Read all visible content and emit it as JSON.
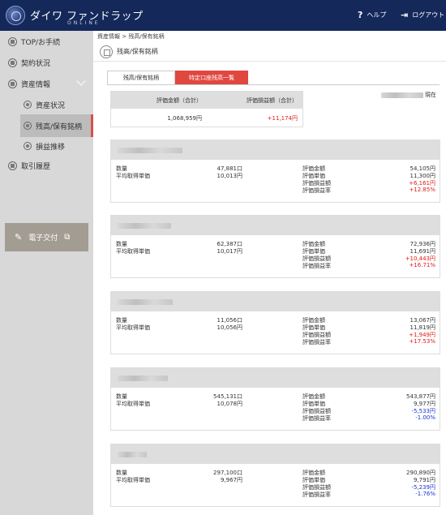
{
  "header": {
    "logo_text": "ダイワ ファンドラップ",
    "logo_sub": "ONLINE",
    "help_label": "ヘルプ",
    "logout_label": "ログアウト"
  },
  "sidebar": {
    "items": [
      {
        "label": "TOP/お手続"
      },
      {
        "label": "契約状況"
      },
      {
        "label": "資産情報"
      },
      {
        "label": "資産状況"
      },
      {
        "label": "残高/保有銘柄"
      },
      {
        "label": "損益推移"
      },
      {
        "label": "取引履歴"
      }
    ],
    "edoc_label": "電子交付"
  },
  "main": {
    "breadcrumb": "資産情報 > 残高/保有銘柄",
    "title": "残高/保有銘柄",
    "tabs": [
      {
        "label": "残高/保有銘柄"
      },
      {
        "label": "特定口座残高一覧"
      }
    ],
    "asof_suffix": "現在",
    "summary": {
      "col1_label": "評価金額（合計）",
      "col2_label": "評価損益額（合計）",
      "col1_value": "1,068,959円",
      "col2_value": "+11,174円"
    },
    "labels": {
      "quantity": "数量",
      "avg_price": "平均取得単価",
      "eval_amount": "評価金額",
      "eval_price": "評価単価",
      "gain_amount": "評価損益額",
      "gain_rate": "評価損益率"
    },
    "holdings": [
      {
        "quantity": "47,881口",
        "avg_price": "10,013円",
        "eval_amount": "54,105円",
        "eval_price": "11,300円",
        "gain_amount": "+6,161円",
        "gain_rate": "+12.85%",
        "sign": "positive"
      },
      {
        "quantity": "62,387口",
        "avg_price": "10,017円",
        "eval_amount": "72,936円",
        "eval_price": "11,691円",
        "gain_amount": "+10,443円",
        "gain_rate": "+16.71%",
        "sign": "positive"
      },
      {
        "quantity": "11,056口",
        "avg_price": "10,056円",
        "eval_amount": "13,067円",
        "eval_price": "11,819円",
        "gain_amount": "+1,949円",
        "gain_rate": "+17.53%",
        "sign": "positive"
      },
      {
        "quantity": "545,131口",
        "avg_price": "10,078円",
        "eval_amount": "543,877円",
        "eval_price": "9,977円",
        "gain_amount": "-5,533円",
        "gain_rate": "-1.00%",
        "sign": "negative"
      },
      {
        "quantity": "297,100口",
        "avg_price": "9,967円",
        "eval_amount": "290,890円",
        "eval_price": "9,791円",
        "gain_amount": "-5,239円",
        "gain_rate": "-1.76%",
        "sign": "negative"
      }
    ]
  },
  "colors": {
    "header_bg": "#14285a",
    "sidebar_bg": "#d8d8d8",
    "active_tab": "#e0473f",
    "positive": "#e01b1b",
    "negative": "#1a35d6"
  },
  "icons": [
    "logo-icon",
    "help-icon",
    "logout-icon",
    "home-icon",
    "contract-icon",
    "asset-icon",
    "chevron-down-icon",
    "asset-status-icon",
    "holdings-icon",
    "pl-trend-icon",
    "history-icon",
    "pen-icon",
    "external-link-icon",
    "page-title-icon"
  ]
}
